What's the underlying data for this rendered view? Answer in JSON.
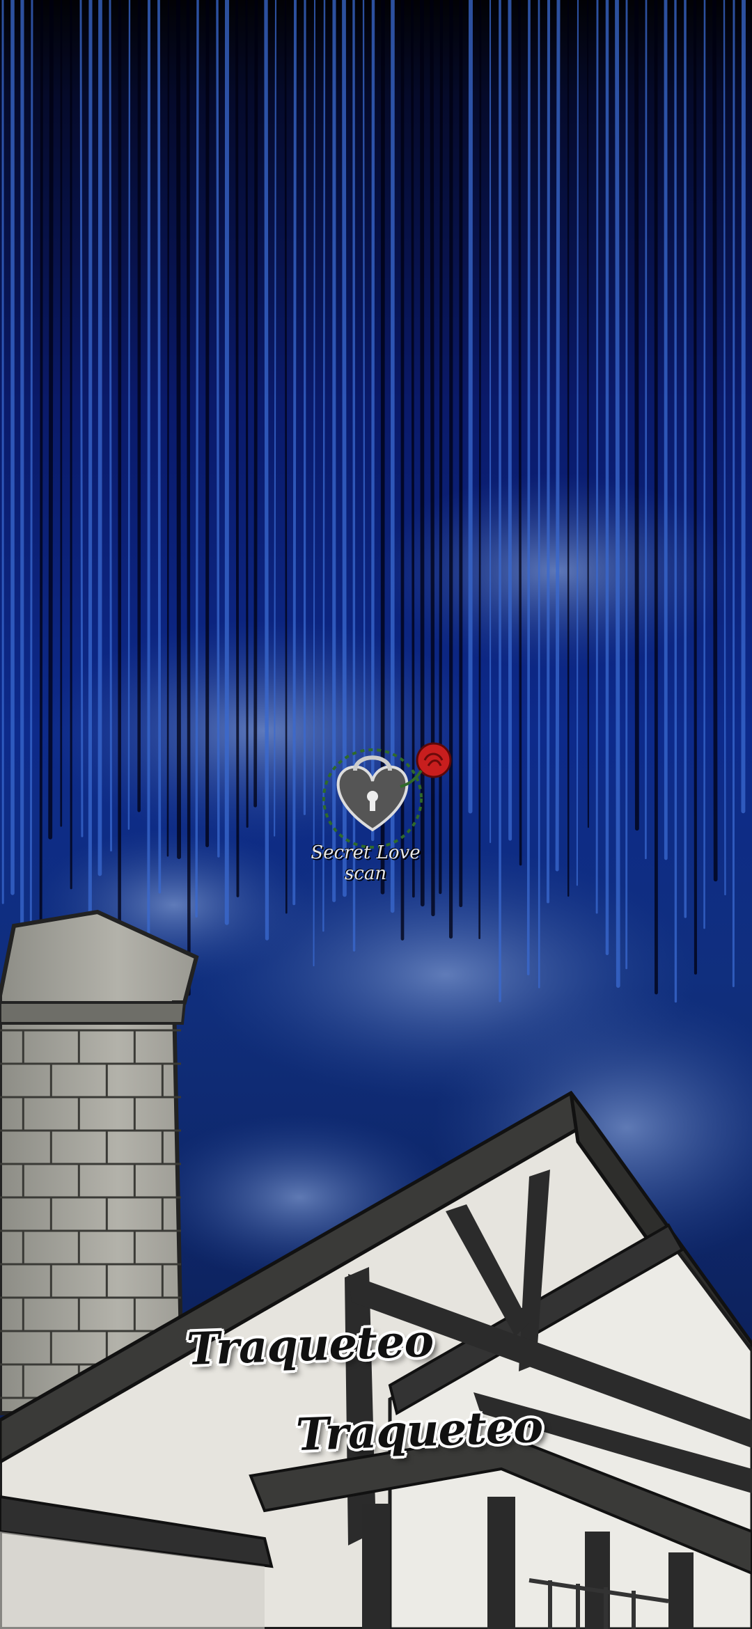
{
  "panel": {
    "sound_effects": [
      "Traqueteo",
      "Traqueteo"
    ]
  },
  "watermark": {
    "text": "Secret Love scan",
    "icon": "heart-lock-rose-icon"
  },
  "colors": {
    "sky_top": "#020205",
    "sky_mid": "#0d2a8a",
    "cloud": "#5a78b8",
    "stone": "#a8a8a0",
    "timber": "#2a2a2a",
    "plaster": "#e8e6e0",
    "rose": "#c81e1e"
  }
}
